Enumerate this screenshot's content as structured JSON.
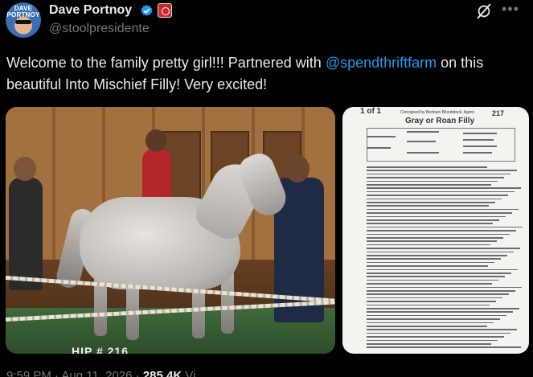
{
  "author": {
    "name": "Dave Portnoy",
    "handle": "@stoolpresidente",
    "avatar_text": "DAVE PORTNOY"
  },
  "tweet": {
    "text_before": "Welcome to the family pretty girl!!!   Partnered with ",
    "mention": "@spendthriftfarm",
    "text_after": " on this beautiful Into Mischief Filly!   Very excited!"
  },
  "media": {
    "photo_caption": "HIP # 216",
    "document": {
      "lot": "1 of 1",
      "consigned_by": "Consigned by Bedouin Bloodstock, Agent",
      "hip_number": "217",
      "title": "Gray or Roan Filly"
    }
  },
  "footer": {
    "time": "9:59 PM · Aug 11, 2026 ·",
    "views": "285.4K",
    "views_label": "Vi"
  },
  "icons": {
    "verified": "verified-badge-icon",
    "affiliate": "affiliate-badge-icon",
    "grok": "grok-icon",
    "more": "more-icon"
  },
  "colors": {
    "background": "#000000",
    "text": "#e7e9ea",
    "muted": "#71767b",
    "accent": "#1d9bf0"
  }
}
